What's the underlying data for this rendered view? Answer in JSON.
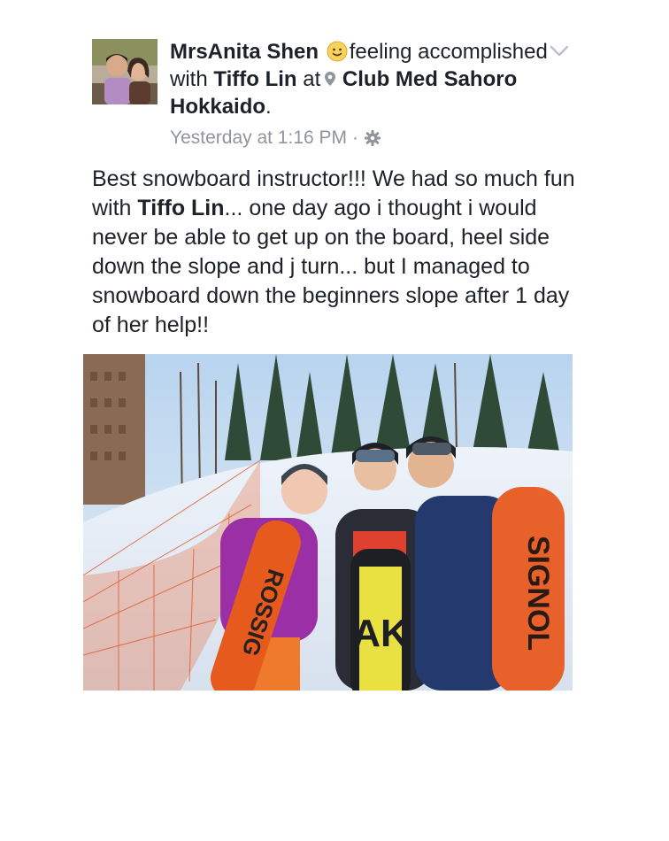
{
  "post": {
    "author_name": "MrsAnita Shen",
    "feeling_text": "feeling",
    "accomplished_text": "accomplished with",
    "tagged_person": "Tiffo Lin",
    "at_text": "at",
    "location": "Club Med Sahoro Hokkaido",
    "period": ".",
    "timestamp": "Yesterday at 1:16 PM",
    "separator": "·",
    "message": {
      "part1": "Best snowboard instructor!!! We had so much fun with ",
      "mention": "Tiffo Lin",
      "part2": "... one day ago i thought i would never be able to get up on the board, heel side down the slope and j turn... but I managed to snowboard down the beginners slope after 1 day of her help!!"
    },
    "board_left_text": "ROSSIG",
    "board_middle_text": "AK",
    "board_right_text": "SIGNOL"
  },
  "icons": {
    "feeling": "feeling-emoji-icon",
    "location": "location-pin-icon",
    "privacy": "gear-icon",
    "menu": "chevron-down-icon"
  }
}
